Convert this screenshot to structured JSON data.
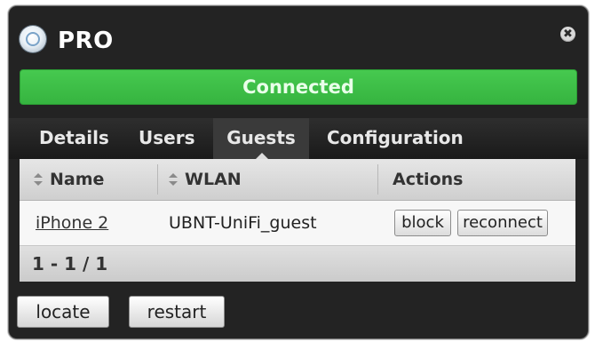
{
  "window": {
    "title": "PRO",
    "close_glyph": "✖",
    "device_icon": "device-status-icon"
  },
  "status": {
    "text": "Connected",
    "color": "#3dbf47"
  },
  "tabs": [
    {
      "label": "Details",
      "active": false
    },
    {
      "label": "Users",
      "active": false
    },
    {
      "label": "Guests",
      "active": true
    },
    {
      "label": "Configuration",
      "active": false
    }
  ],
  "table": {
    "columns": [
      "Name",
      "WLAN",
      "Actions"
    ],
    "rows": [
      {
        "name": "iPhone 2",
        "wlan": "UBNT-UniFi_guest",
        "actions": [
          "block",
          "reconnect"
        ]
      }
    ],
    "pagination": "1 - 1 / 1"
  },
  "footer_buttons": {
    "locate": "locate",
    "restart": "restart"
  }
}
